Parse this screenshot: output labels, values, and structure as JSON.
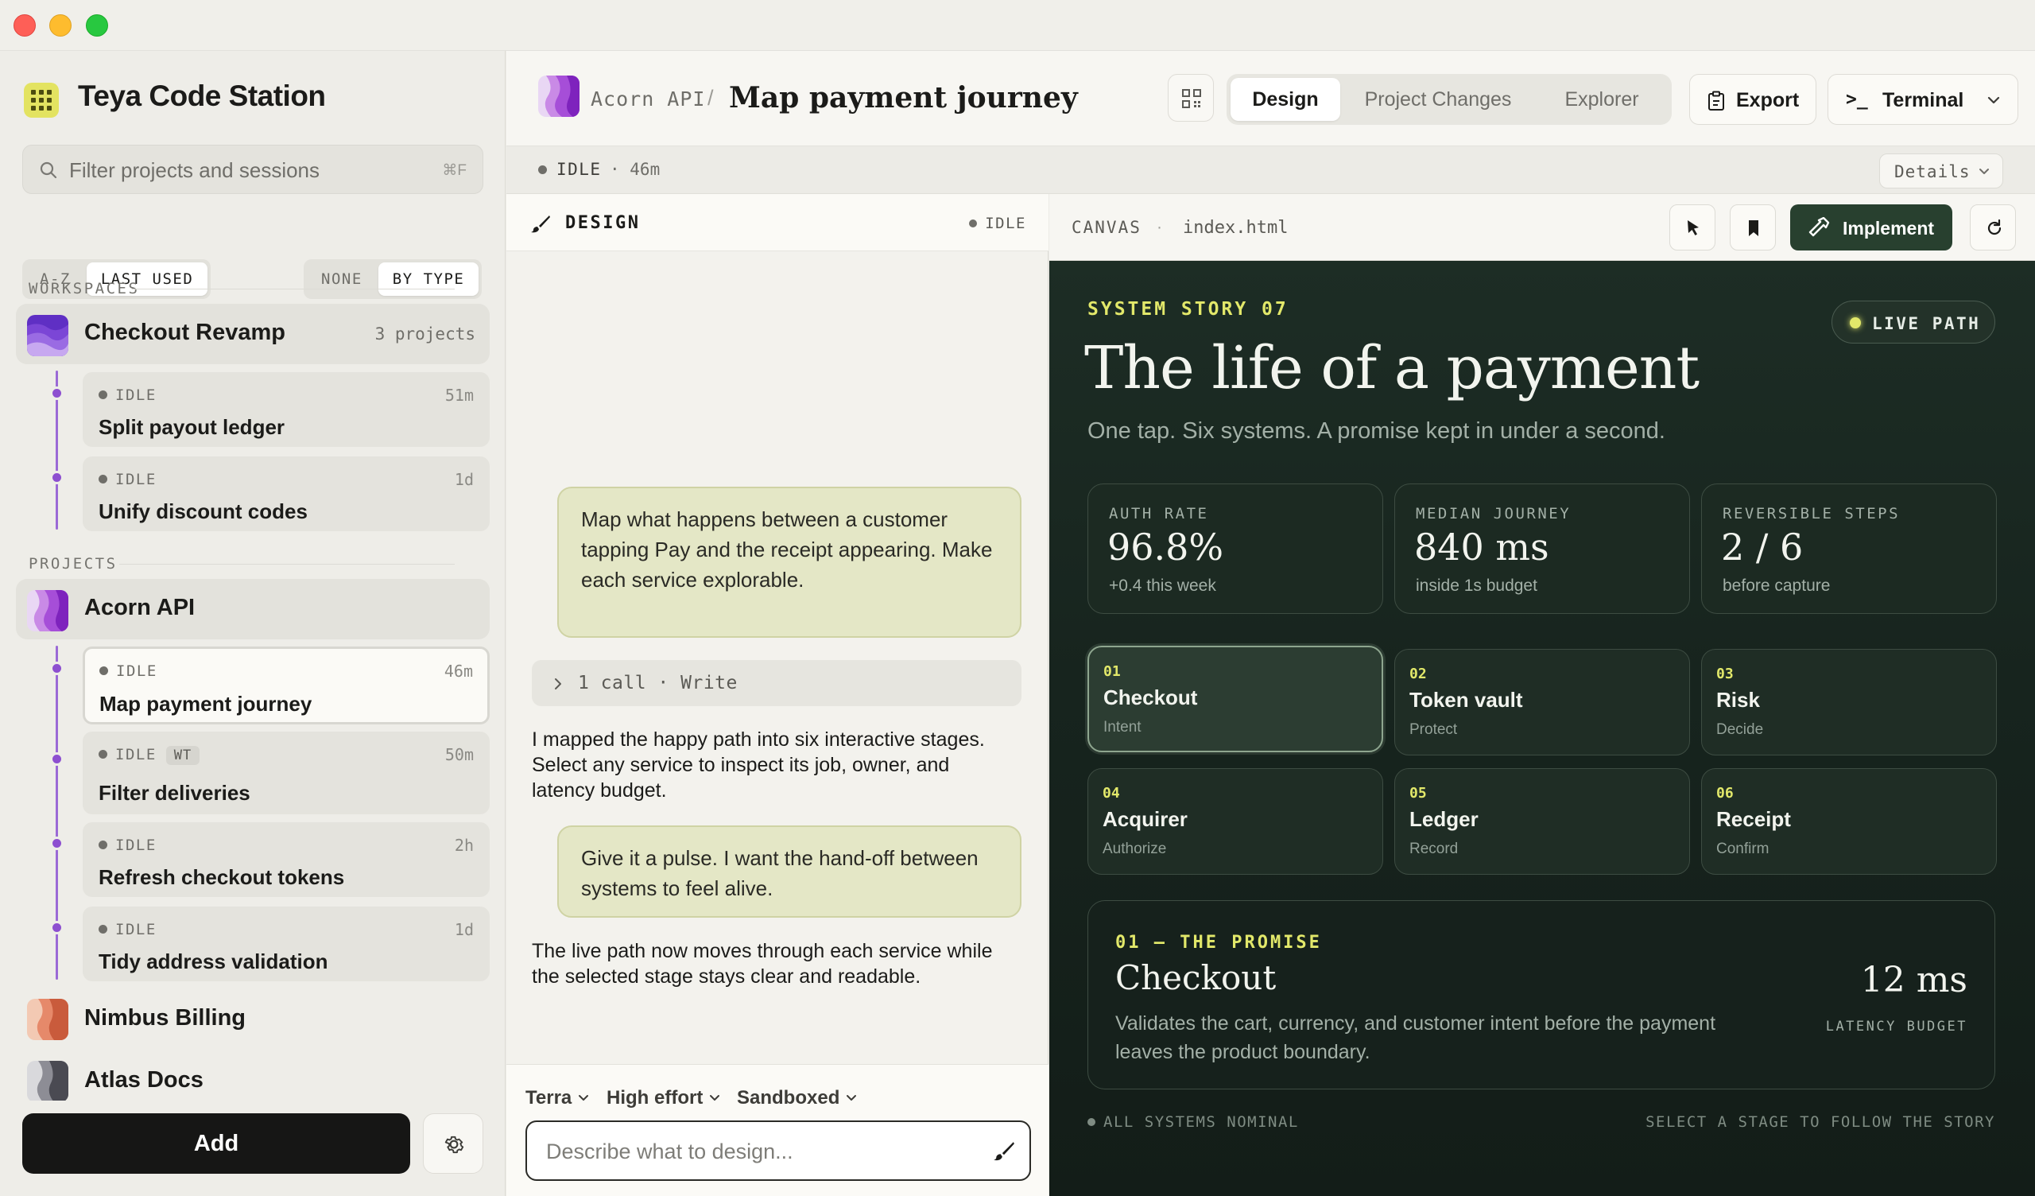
{
  "app": {
    "title": "Teya Code Station"
  },
  "sidebar": {
    "search": {
      "placeholder": "Filter projects and sessions",
      "shortcut": "⌘F"
    },
    "sort": {
      "options": [
        "A-Z",
        "LAST USED"
      ],
      "selected": "LAST USED"
    },
    "group": {
      "options": [
        "NONE",
        "BY TYPE"
      ],
      "selected": "BY TYPE"
    },
    "workspaces_heading": "WORKSPACES",
    "workspace": {
      "name": "Checkout Revamp",
      "count": "3 projects"
    },
    "workspace_sessions": [
      {
        "status": "IDLE",
        "time": "51m",
        "title": "Split payout ledger"
      },
      {
        "status": "IDLE",
        "time": "1d",
        "title": "Unify discount codes"
      }
    ],
    "projects_heading": "PROJECTS",
    "project": {
      "name": "Acorn API"
    },
    "project_sessions": [
      {
        "status": "IDLE",
        "time": "46m",
        "title": "Map payment journey",
        "badge": ""
      },
      {
        "status": "IDLE",
        "time": "50m",
        "title": "Filter deliveries",
        "badge": "WT"
      },
      {
        "status": "IDLE",
        "time": "2h",
        "title": "Refresh checkout tokens",
        "badge": ""
      },
      {
        "status": "IDLE",
        "time": "1d",
        "title": "Tidy address validation",
        "badge": ""
      }
    ],
    "other_projects": [
      {
        "name": "Nimbus Billing"
      },
      {
        "name": "Atlas Docs"
      }
    ],
    "add_label": "Add",
    "settings_icon": "gear-icon"
  },
  "header": {
    "project": "Acorn API",
    "separator": "/",
    "title": "Map payment journey",
    "tabs": [
      "Design",
      "Project Changes",
      "Explorer"
    ],
    "active_tab": "Design",
    "export_label": "Export",
    "terminal_prompt": ">_",
    "terminal_label": "Terminal"
  },
  "status_bar": {
    "status": "IDLE",
    "elapsed": "· 46m",
    "details_label": "Details"
  },
  "design_panel": {
    "title": "DESIGN",
    "status": "IDLE",
    "messages": [
      {
        "role": "user",
        "text": "Map what happens between a customer tapping Pay and the receipt appearing. Make each service explorable."
      },
      {
        "role": "tool",
        "text": "1 call · Write"
      },
      {
        "role": "assistant",
        "text": "I mapped the happy path into six interactive stages. Select any service to inspect its job, owner, and latency budget."
      },
      {
        "role": "user",
        "text": "Give it a pulse. I want the hand-off between systems to feel alive."
      },
      {
        "role": "assistant",
        "text": "The live path now moves through each service while the selected stage stays clear and readable."
      }
    ],
    "composer": {
      "model": "Terra",
      "effort": "High effort",
      "mode": "Sandboxed",
      "placeholder": "Describe what to design..."
    }
  },
  "canvas": {
    "label": "CANVAS",
    "dot": "·",
    "file": "index.html",
    "implement_label": "Implement",
    "content": {
      "kicker": "SYSTEM STORY 07",
      "live_label": "LIVE PATH",
      "headline": "The life of a payment",
      "subhead": "One tap. Six systems. A promise kept in under a second.",
      "stats": [
        {
          "label": "AUTH RATE",
          "value": "96.8%",
          "note": "+0.4 this week"
        },
        {
          "label": "MEDIAN JOURNEY",
          "value": "840 ms",
          "note": "inside 1s budget"
        },
        {
          "label": "REVERSIBLE STEPS",
          "value": "2 / 6",
          "note": "before capture"
        }
      ],
      "stages": [
        {
          "num": "01",
          "name": "Checkout",
          "sub": "Intent"
        },
        {
          "num": "02",
          "name": "Token vault",
          "sub": "Protect"
        },
        {
          "num": "03",
          "name": "Risk",
          "sub": "Decide"
        },
        {
          "num": "04",
          "name": "Acquirer",
          "sub": "Authorize"
        },
        {
          "num": "05",
          "name": "Ledger",
          "sub": "Record"
        },
        {
          "num": "06",
          "name": "Receipt",
          "sub": "Confirm"
        }
      ],
      "selected_stage": "01",
      "promise": {
        "kicker": "01 — THE PROMISE",
        "title": "Checkout",
        "desc": "Validates the cart, currency, and customer intent before the payment leaves the product boundary.",
        "latency": "12 ms",
        "latency_label": "LATENCY BUDGET"
      },
      "footer_left": "ALL SYSTEMS NOMINAL",
      "footer_right": "SELECT A STAGE TO FOLLOW THE STORY"
    }
  },
  "colors": {
    "accent_dark": "#28402f",
    "highlight": "#e2e86a",
    "tree": "#8d4fd0",
    "user_bubble": "#e4e7c6"
  }
}
